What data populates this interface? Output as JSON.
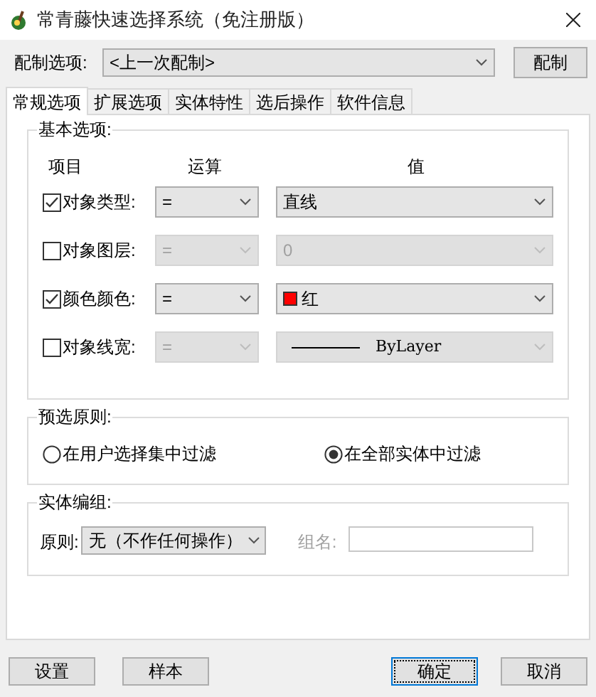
{
  "window": {
    "title": "常青藤快速选择系统（免注册版）"
  },
  "preset": {
    "label": "配制选项:",
    "value": "<上一次配制>",
    "button": "配制"
  },
  "tabs": [
    {
      "label": "常规选项",
      "selected": true
    },
    {
      "label": "扩展选项",
      "selected": false
    },
    {
      "label": "实体特性",
      "selected": false
    },
    {
      "label": "选后操作",
      "selected": false
    },
    {
      "label": "软件信息",
      "selected": false
    }
  ],
  "basic": {
    "title": "基本选项:",
    "headers": [
      "项目",
      "运算",
      "值"
    ],
    "rows": [
      {
        "kind": "text",
        "label": "对象类型:",
        "checked": true,
        "operator": "=",
        "value": "直线"
      },
      {
        "kind": "text",
        "label": "对象图层:",
        "checked": false,
        "operator": "=",
        "value": "0"
      },
      {
        "kind": "color",
        "label": "颜色颜色:",
        "checked": true,
        "operator": "=",
        "value": "红",
        "color": "#ff0000"
      },
      {
        "kind": "lineweight",
        "label": "对象线宽:",
        "checked": false,
        "operator": "=",
        "value": "ByLayer"
      }
    ]
  },
  "prefilter": {
    "title": "预选原则:",
    "options": [
      {
        "label": "在用户选择集中过滤",
        "selected": false
      },
      {
        "label": "在全部实体中过滤",
        "selected": true
      }
    ]
  },
  "grouping": {
    "title": "实体编组:",
    "rule_label": "原则:",
    "rule_value": "无（不作任何操作）",
    "name_label": "组名:",
    "name_disabled": true
  },
  "buttons": [
    {
      "label": "设置",
      "focused": false
    },
    {
      "label": "样本",
      "focused": false
    },
    {
      "label": "确定",
      "focused": true
    },
    {
      "label": "取消",
      "focused": false
    }
  ]
}
